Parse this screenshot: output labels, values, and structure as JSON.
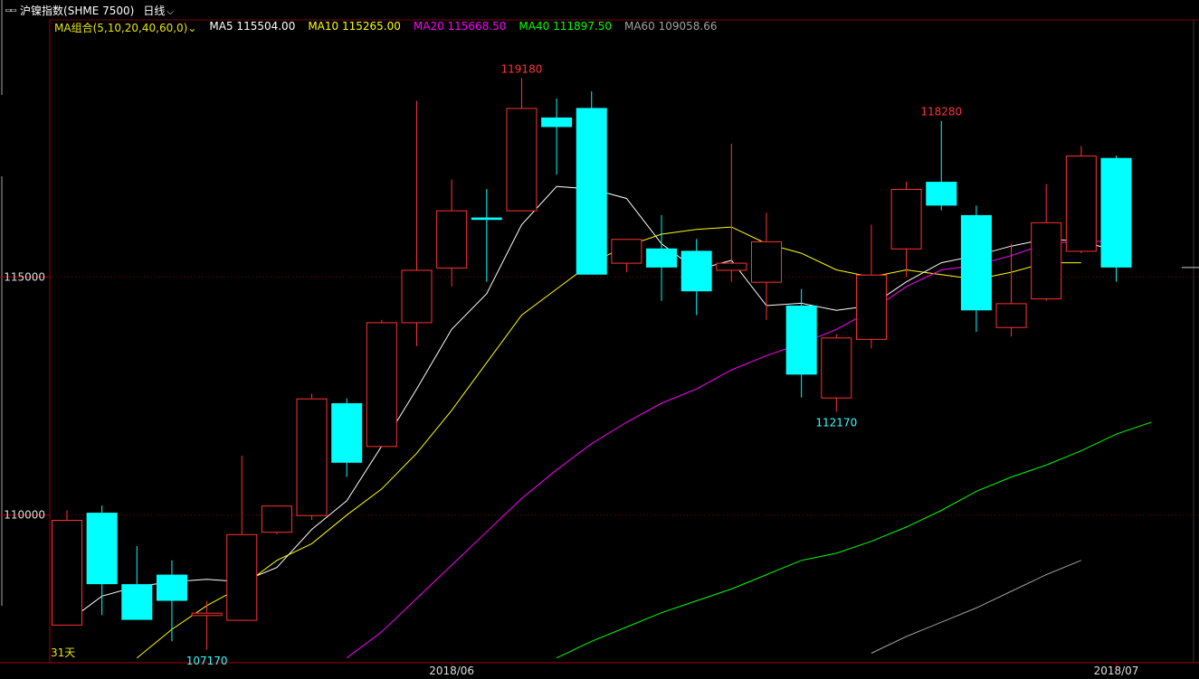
{
  "header": {
    "instrument": "沪镍指数(SHME 7500)",
    "period": "日线"
  },
  "ma_legend": {
    "combo": "MA组合(5,10,20,40,60,0)",
    "items": [
      {
        "label": "MA5 115504.00",
        "color": "#ffffff"
      },
      {
        "label": "MA10 115265.00",
        "color": "#ffff00"
      },
      {
        "label": "MA20 115668.50",
        "color": "#ff00ff"
      },
      {
        "label": "MA40 111897.50",
        "color": "#00ff00"
      },
      {
        "label": "MA60 109058.66",
        "color": "#a0a0a0"
      }
    ]
  },
  "chart_data": {
    "type": "candlestick",
    "y_ticks": [
      115000,
      110000
    ],
    "y_range": [
      106900,
      120400
    ],
    "x_labels": [
      {
        "text": "2018/06",
        "index": 11
      },
      {
        "text": "2018/07",
        "index": 30
      }
    ],
    "day_count_label": "31天",
    "annotations": [
      {
        "text": "119180",
        "index": 13,
        "value": 119180,
        "color": "#ff3333"
      },
      {
        "text": "118280",
        "index": 25,
        "value": 118280,
        "color": "#ff3333"
      },
      {
        "text": "112170",
        "index": 22,
        "value": 112170,
        "color": "#33ffff"
      },
      {
        "text": "107170",
        "index": 4,
        "value": 107170,
        "color": "#33ffff"
      }
    ],
    "colors": {
      "up": "#ff3333",
      "down": "#00ffff"
    },
    "candles": [
      {
        "o": 107700,
        "h": 110100,
        "l": 107700,
        "c": 109900
      },
      {
        "o": 110050,
        "h": 110200,
        "l": 107900,
        "c": 108550
      },
      {
        "o": 108550,
        "h": 109350,
        "l": 107800,
        "c": 107800
      },
      {
        "o": 108750,
        "h": 109050,
        "l": 107350,
        "c": 108200
      },
      {
        "o": 107900,
        "h": 108200,
        "l": 107170,
        "c": 107950
      },
      {
        "o": 107800,
        "h": 111250,
        "l": 107800,
        "c": 109600
      },
      {
        "o": 109650,
        "h": 110200,
        "l": 109600,
        "c": 110200
      },
      {
        "o": 110000,
        "h": 112550,
        "l": 109900,
        "c": 112450
      },
      {
        "o": 112350,
        "h": 112450,
        "l": 110800,
        "c": 111100
      },
      {
        "o": 111450,
        "h": 114100,
        "l": 111450,
        "c": 114050
      },
      {
        "o": 114050,
        "h": 118700,
        "l": 113550,
        "c": 115150
      },
      {
        "o": 115200,
        "h": 117050,
        "l": 114800,
        "c": 116400
      },
      {
        "o": 116250,
        "h": 116850,
        "l": 114900,
        "c": 116200
      },
      {
        "o": 116400,
        "h": 119180,
        "l": 116400,
        "c": 118550
      },
      {
        "o": 118350,
        "h": 118750,
        "l": 117150,
        "c": 118150
      },
      {
        "o": 118550,
        "h": 118900,
        "l": 115050,
        "c": 115050
      },
      {
        "o": 115300,
        "h": 115450,
        "l": 115100,
        "c": 115800
      },
      {
        "o": 115600,
        "h": 116300,
        "l": 114500,
        "c": 115200
      },
      {
        "o": 115550,
        "h": 115800,
        "l": 114200,
        "c": 114700
      },
      {
        "o": 115150,
        "h": 117800,
        "l": 114900,
        "c": 115300
      },
      {
        "o": 114900,
        "h": 116350,
        "l": 114100,
        "c": 115750
      },
      {
        "o": 114400,
        "h": 114750,
        "l": 112470,
        "c": 112950
      },
      {
        "o": 112470,
        "h": 113800,
        "l": 112170,
        "c": 113730
      },
      {
        "o": 113700,
        "h": 116100,
        "l": 113500,
        "c": 115050
      },
      {
        "o": 115600,
        "h": 117000,
        "l": 115000,
        "c": 116850
      },
      {
        "o": 117000,
        "h": 118280,
        "l": 116400,
        "c": 116500
      },
      {
        "o": 116300,
        "h": 116500,
        "l": 113850,
        "c": 114300
      },
      {
        "o": 113950,
        "h": 115700,
        "l": 113750,
        "c": 114450
      },
      {
        "o": 114550,
        "h": 116950,
        "l": 114500,
        "c": 116150
      },
      {
        "o": 115550,
        "h": 117750,
        "l": 115500,
        "c": 117550
      },
      {
        "o": 117500,
        "h": 117550,
        "l": 114900,
        "c": 115200
      }
    ],
    "ma_series": [
      {
        "name": "MA5",
        "color": "#ffffff",
        "start": 0,
        "values": [
          107750,
          108300,
          108500,
          108600,
          108650,
          108600,
          108900,
          109700,
          110300,
          111450,
          112650,
          113900,
          114650,
          116100,
          116900,
          116850,
          116650,
          115700,
          115150,
          115350,
          114400,
          114450,
          114300,
          114400,
          114900,
          115300,
          115450,
          115650,
          115800,
          115750,
          115550
        ]
      },
      {
        "name": "MA10",
        "color": "#ffff00",
        "start": 2,
        "values": [
          107000,
          107600,
          108100,
          108500,
          109050,
          109400,
          110000,
          110550,
          111300,
          112200,
          113200,
          114200,
          114750,
          115300,
          115650,
          115900,
          116000,
          116050,
          115700,
          115500,
          115150,
          115000,
          115150,
          115050,
          114950,
          115100,
          115300,
          115300
        ]
      },
      {
        "name": "MA20",
        "color": "#ff00ff",
        "start": 8,
        "values": [
          107000,
          107550,
          108250,
          108950,
          109650,
          110350,
          110950,
          111500,
          111950,
          112350,
          112650,
          113050,
          113350,
          113600,
          113900,
          114300,
          114800,
          115150,
          115250,
          115450,
          115700,
          115750,
          115750
        ]
      },
      {
        "name": "MA40",
        "color": "#00ff00",
        "start": 14,
        "values": [
          107000,
          107350,
          107650,
          107950,
          108200,
          108450,
          108750,
          109050,
          109200,
          109450,
          109750,
          110100,
          110500,
          110800,
          111050,
          111350,
          111700,
          111950
        ]
      },
      {
        "name": "MA60",
        "color": "#a0a0a0",
        "start": 23,
        "values": [
          107100,
          107450,
          107750,
          108050,
          108400,
          108750,
          109050
        ]
      }
    ],
    "last_price_line": 115200
  }
}
